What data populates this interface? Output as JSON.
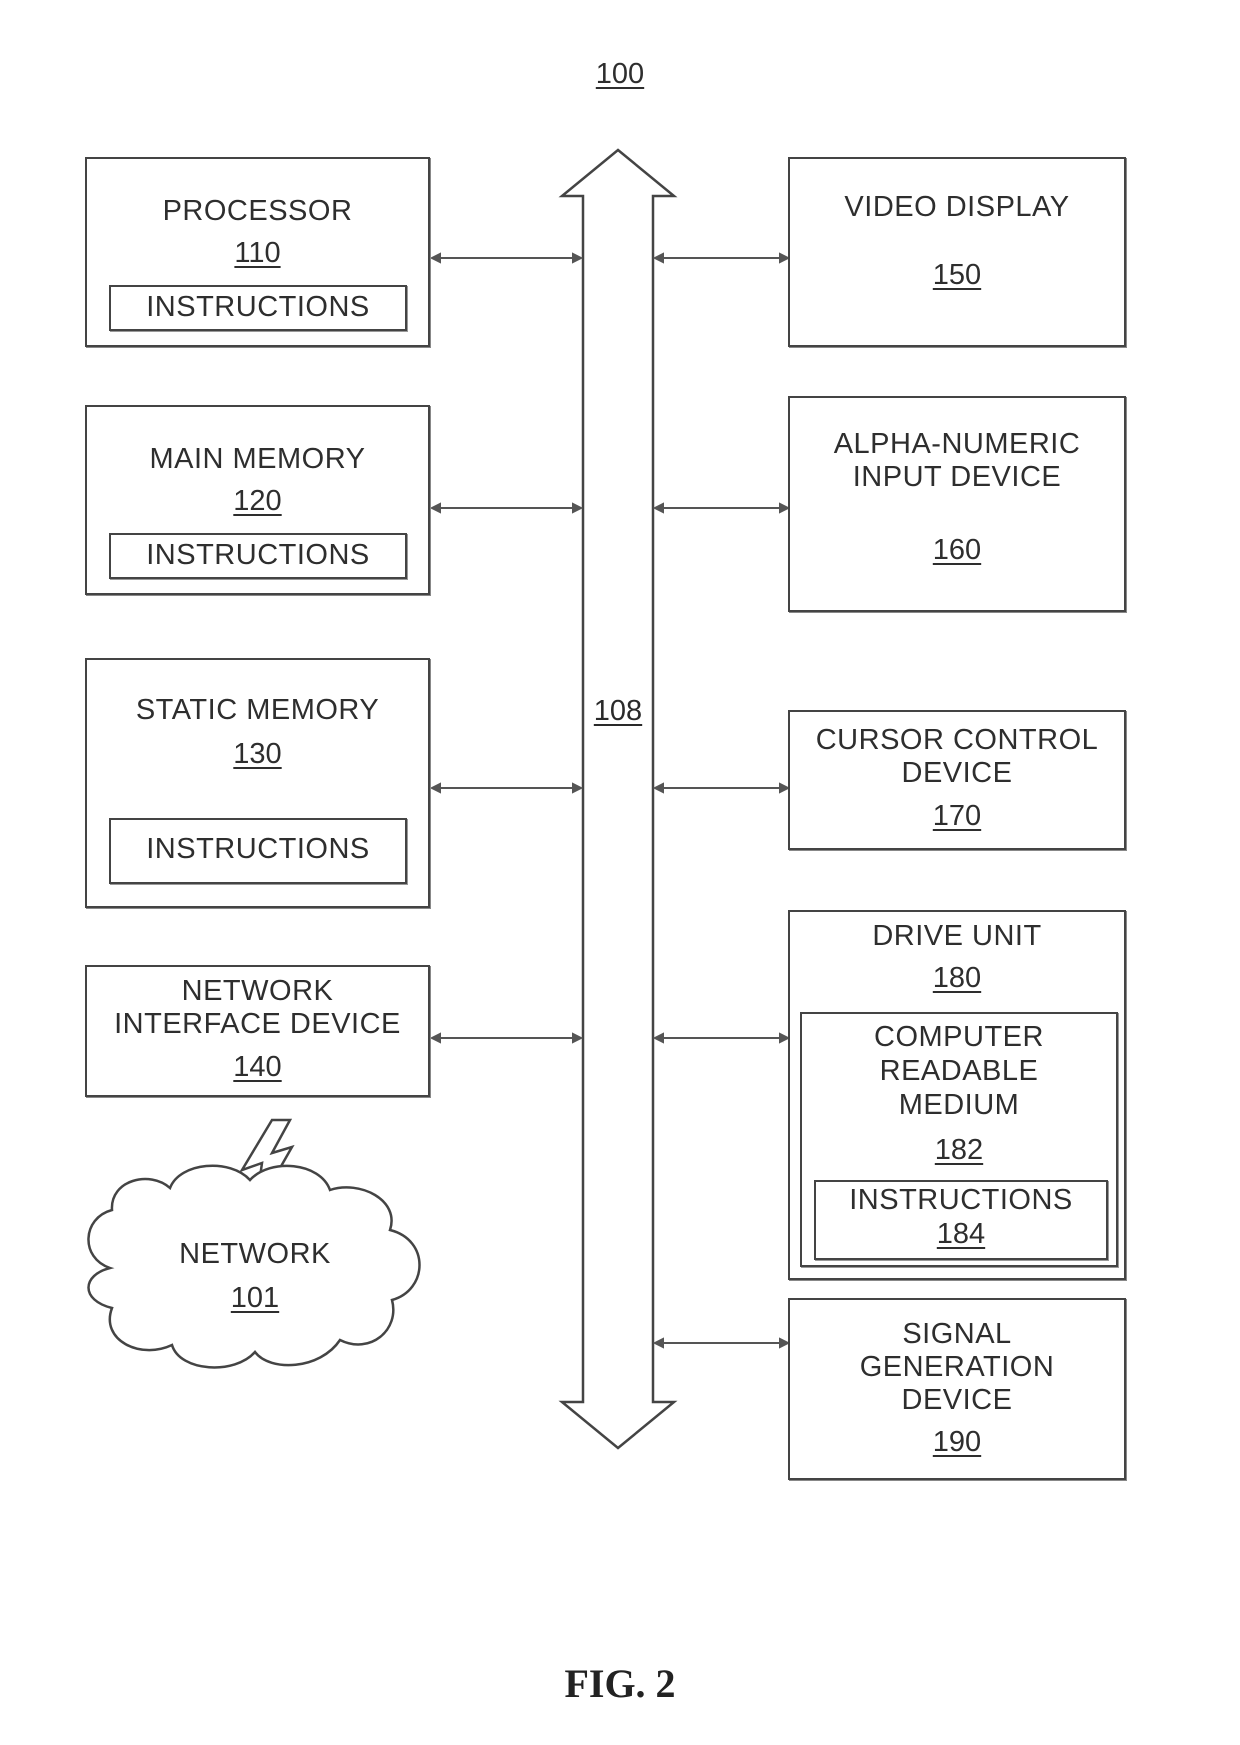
{
  "figure": {
    "ref_top": "100",
    "caption": "FIG. 2",
    "bus_ref": "108"
  },
  "left_blocks": [
    {
      "title": "PROCESSOR",
      "ref": "110",
      "inner": "INSTRUCTIONS"
    },
    {
      "title": "MAIN MEMORY",
      "ref": "120",
      "inner": "INSTRUCTIONS"
    },
    {
      "title": "STATIC MEMORY",
      "ref": "130",
      "inner": "INSTRUCTIONS"
    },
    {
      "title": "NETWORK\nINTERFACE DEVICE",
      "ref": "140"
    }
  ],
  "network": {
    "title": "NETWORK",
    "ref": "101"
  },
  "right_blocks": [
    {
      "title": "VIDEO DISPLAY",
      "ref": "150"
    },
    {
      "title": "ALPHA-NUMERIC\nINPUT DEVICE",
      "ref": "160"
    },
    {
      "title": "CURSOR CONTROL\nDEVICE",
      "ref": "170"
    },
    {
      "title": "DRIVE UNIT",
      "ref": "180",
      "medium": {
        "title": "COMPUTER\nREADABLE\nMEDIUM",
        "ref": "182",
        "instructions": {
          "title": "INSTRUCTIONS",
          "ref": "184"
        }
      }
    },
    {
      "title": "SIGNAL\nGENERATION\nDEVICE",
      "ref": "190"
    }
  ],
  "colors": {
    "line": "#444444",
    "background": "#ffffff"
  }
}
